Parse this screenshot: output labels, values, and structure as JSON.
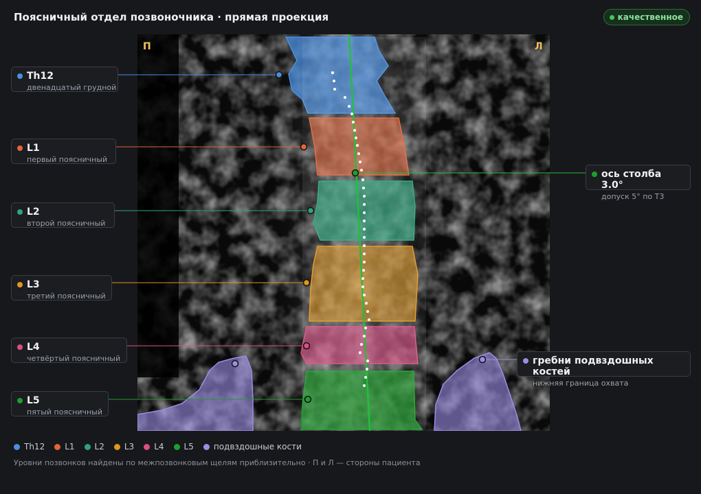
{
  "header": {
    "title": "Поясничный отдел позвоночника · прямая проекция",
    "quality_badge": "качественное"
  },
  "orientation": {
    "right_marker": "П",
    "left_marker": "Л"
  },
  "vertebrae": [
    {
      "id": "Th12",
      "name": "Th12",
      "desc": "двенадцатый грудной",
      "color": "#4a8fe0"
    },
    {
      "id": "L1",
      "name": "L1",
      "desc": "первый поясничный",
      "color": "#e0653a"
    },
    {
      "id": "L2",
      "name": "L2",
      "desc": "второй поясничный",
      "color": "#2fa37c"
    },
    {
      "id": "L3",
      "name": "L3",
      "desc": "третий поясничный",
      "color": "#e0961f"
    },
    {
      "id": "L4",
      "name": "L4",
      "desc": "четвёртый поясничный",
      "color": "#d94f82"
    },
    {
      "id": "L5",
      "name": "L5",
      "desc": "пятый поясничный",
      "color": "#1e9e2c"
    }
  ],
  "spine_axis": {
    "label": "ось столба 3.0°",
    "desc": "допуск 5° по Т3",
    "angle_deg": 3.0,
    "color": "#22c03a"
  },
  "iliac": {
    "label": "гребни подвздошных костей",
    "desc": "нижняя граница охвата",
    "color": "#9b8ee6"
  },
  "legend": [
    {
      "label": "Th12",
      "color": "#4a8fe0"
    },
    {
      "label": "L1",
      "color": "#e0653a"
    },
    {
      "label": "L2",
      "color": "#2fa37c"
    },
    {
      "label": "L3",
      "color": "#e0961f"
    },
    {
      "label": "L4",
      "color": "#d94f82"
    },
    {
      "label": "L5",
      "color": "#1e9e2c"
    },
    {
      "label": "подвздошные кости",
      "color": "#9b8ee6"
    }
  ],
  "footer": {
    "note": "Уровни позвонков найдены по межпозвонковым щелям приблизительно · П и Л — стороны пациента"
  }
}
